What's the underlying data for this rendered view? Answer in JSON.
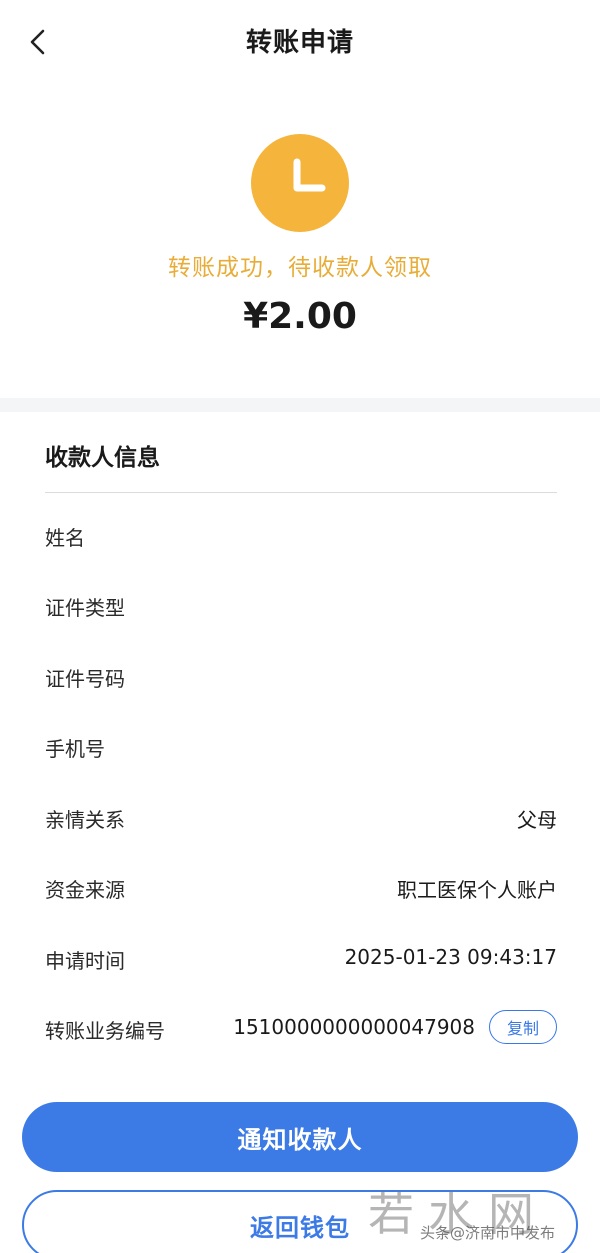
{
  "header": {
    "title": "转账申请",
    "back_icon": "chevron-left-icon"
  },
  "status": {
    "icon": "clock-icon",
    "icon_color": "#f5b43c",
    "text": "转账成功，待收款人领取",
    "text_color": "#e8ad38",
    "amount": "¥2.00"
  },
  "payee": {
    "section_title": "收款人信息",
    "rows": [
      {
        "label": "姓名",
        "value": ""
      },
      {
        "label": "证件类型",
        "value": ""
      },
      {
        "label": "证件号码",
        "value": ""
      },
      {
        "label": "手机号",
        "value": ""
      },
      {
        "label": "亲情关系",
        "value": "父母"
      },
      {
        "label": "资金来源",
        "value": "职工医保个人账户"
      },
      {
        "label": "申请时间",
        "value": "2025-01-23 09:43:17"
      },
      {
        "label": "转账业务编号",
        "value": "1510000000000047908",
        "action": "复制"
      }
    ]
  },
  "actions": {
    "primary_label": "通知收款人",
    "secondary_label": "返回钱包",
    "accent_color": "#3c7ae6"
  },
  "watermark": {
    "big": "若水网",
    "small": "头条@济南市中发布"
  }
}
